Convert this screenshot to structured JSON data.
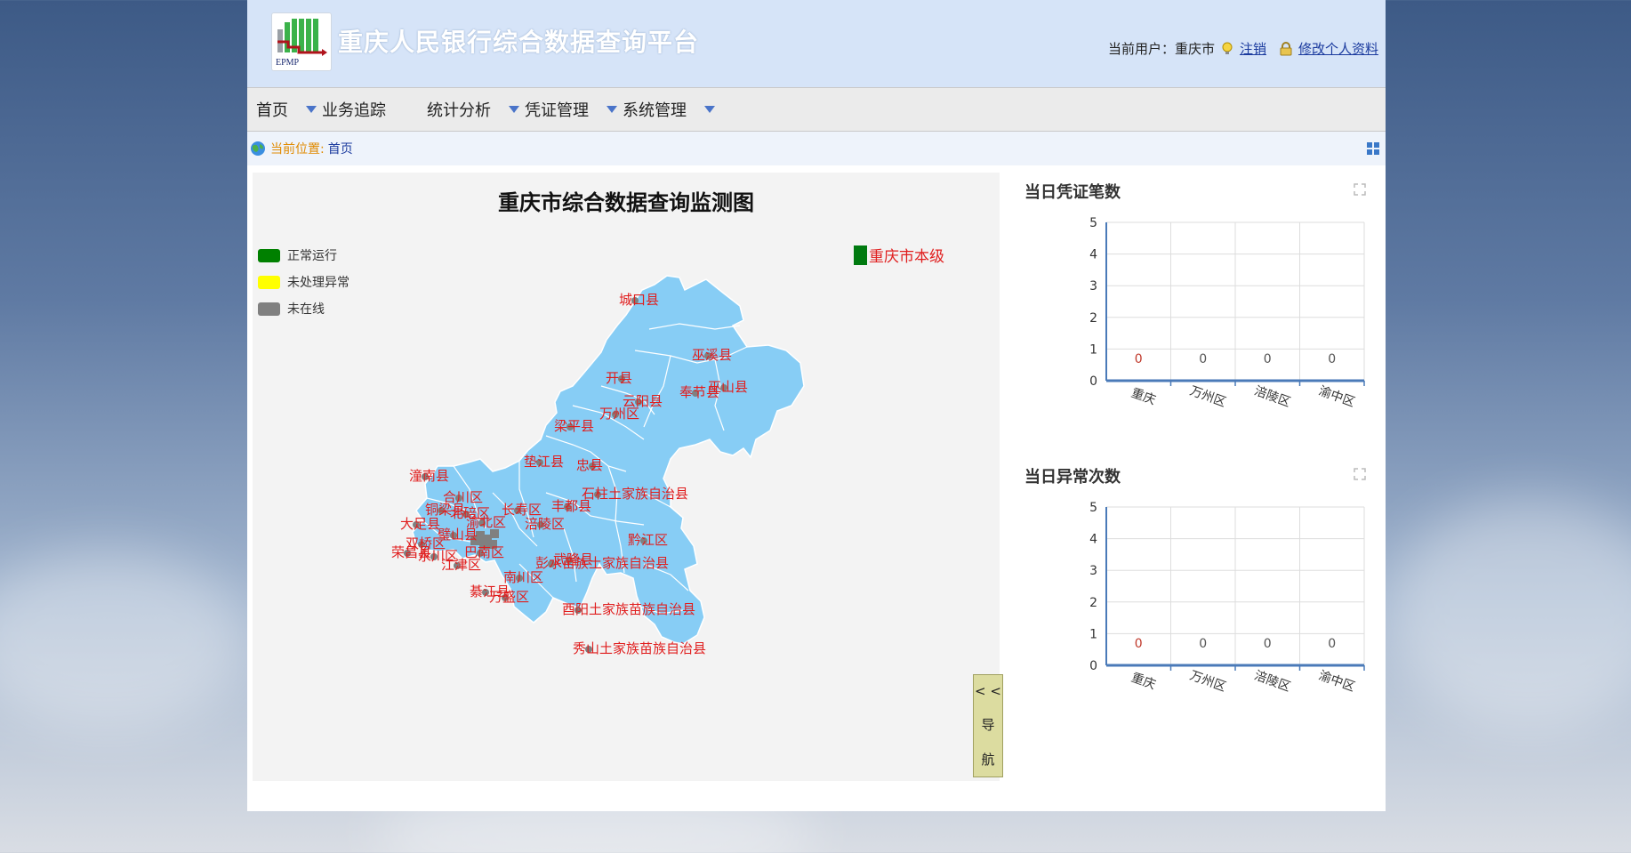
{
  "header": {
    "logo_text": "EPMP",
    "app_title": "重庆人民银行综合数据查询平台",
    "current_user_label": "当前用户：重庆市",
    "logout_label": "注销",
    "edit_profile_label": "修改个人资料"
  },
  "menu": {
    "items": [
      {
        "label": "首页"
      },
      {
        "label": "业务追踪"
      },
      {
        "label": "统计分析"
      },
      {
        "label": "凭证管理"
      },
      {
        "label": "系统管理"
      }
    ]
  },
  "breadcrumb": {
    "label": "当前位置:",
    "current": "首页"
  },
  "map": {
    "title": "重庆市综合数据查询监测图",
    "legend": [
      {
        "label": "正常运行",
        "color": "#008000"
      },
      {
        "label": "未处理异常",
        "color": "#ffff00"
      },
      {
        "label": "未在线",
        "color": "#808080"
      }
    ],
    "city_level_label": "重庆市本级",
    "region_fill": "#87cdf5",
    "label_color": "#e01e1e",
    "district_labels": [
      "城口县",
      "巫溪县",
      "开县",
      "巫山县",
      "奉节县",
      "云阳县",
      "万州区",
      "梁平县",
      "垫江县",
      "忠县",
      "潼南县",
      "合川区",
      "石柱土家族自治县",
      "铜梁县",
      "北碚区",
      "长寿区",
      "丰都县",
      "大足县",
      "渝北区",
      "涪陵区",
      "璧山县",
      "双桥区",
      "黔江区",
      "荣昌县",
      "永川区",
      "江津区",
      "巴南区",
      "彭水苗族土家族自治县",
      "武隆县",
      "南川区",
      "綦江县",
      "万盛区",
      "酉阳土家族苗族自治县",
      "秀山土家族苗族自治县"
    ],
    "nav_toggle": {
      "arrow": "< <",
      "label1": "导",
      "label2": "航"
    }
  },
  "charts": [
    {
      "title": "当日凭证笔数",
      "chart_data": {
        "type": "bar",
        "categories": [
          "重庆",
          "万州区",
          "涪陵区",
          "渝中区"
        ],
        "values": [
          0,
          0,
          0,
          0
        ],
        "ylim": [
          0,
          5
        ],
        "yticks": [
          0,
          1,
          2,
          3,
          4,
          5
        ],
        "data_labels": [
          "0",
          "0",
          "0",
          "0"
        ]
      }
    },
    {
      "title": "当日异常次数",
      "chart_data": {
        "type": "bar",
        "categories": [
          "重庆",
          "万州区",
          "涪陵区",
          "渝中区"
        ],
        "values": [
          0,
          0,
          0,
          0
        ],
        "ylim": [
          0,
          5
        ],
        "yticks": [
          0,
          1,
          2,
          3,
          4,
          5
        ],
        "data_labels": [
          "0",
          "0",
          "0",
          "0"
        ]
      }
    }
  ]
}
